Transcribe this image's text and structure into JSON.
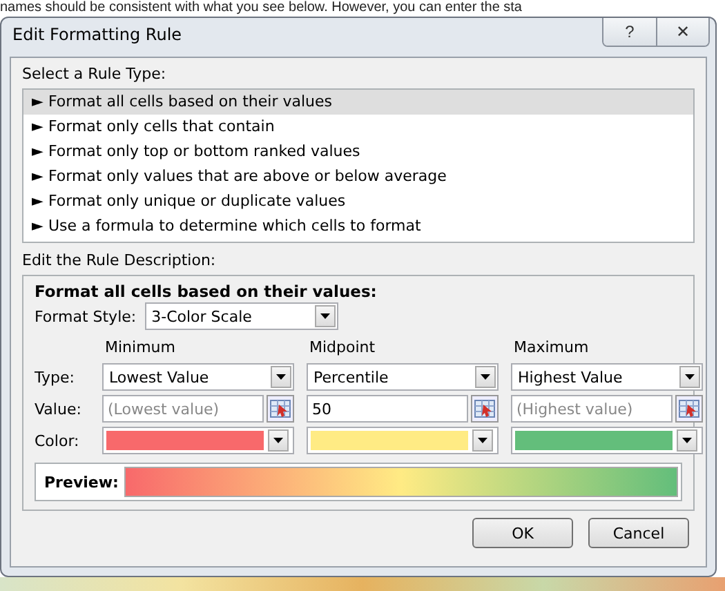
{
  "background_text": "names should be consistent with what you see below. However, you can enter the sta",
  "window": {
    "title": "Edit Formatting Rule",
    "help": "?",
    "close": "✕"
  },
  "rule_type_label": "Select a Rule Type:",
  "rule_types": [
    {
      "label": "► Format all cells based on their values",
      "selected": true
    },
    {
      "label": "► Format only cells that contain",
      "selected": false
    },
    {
      "label": "► Format only top or bottom ranked values",
      "selected": false
    },
    {
      "label": "► Format only values that are above or below average",
      "selected": false
    },
    {
      "label": "► Format only unique or duplicate values",
      "selected": false
    },
    {
      "label": "► Use a formula to determine which cells to format",
      "selected": false
    }
  ],
  "description_label": "Edit the Rule Description:",
  "description": {
    "heading": "Format all cells based on their values:",
    "format_style_label": "Format Style:",
    "format_style": "3-Color Scale",
    "row_labels": [
      "Type:",
      "Value:",
      "Color:"
    ],
    "points": [
      {
        "heading": "Minimum",
        "type": "Lowest Value",
        "placeholder": "(Lowest value)",
        "color": "#f8696b"
      },
      {
        "heading": "Midpoint",
        "type": "Percentile",
        "value": "50",
        "color": "#ffeb84"
      },
      {
        "heading": "Maximum",
        "type": "Highest Value",
        "placeholder": "(Highest value)",
        "color": "#63be7b"
      }
    ],
    "preview_label": "Preview:"
  },
  "buttons": [
    "OK",
    "Cancel"
  ]
}
